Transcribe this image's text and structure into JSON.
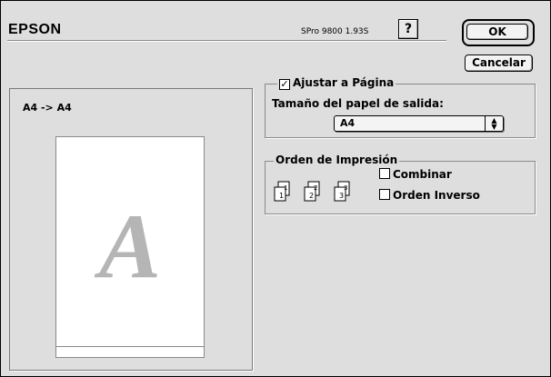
{
  "header": {
    "brand": "EPSON",
    "version": "SPro 9800 1.93S",
    "help_label": "?",
    "ok_label": "OK",
    "cancel_label": "Cancelar"
  },
  "preview": {
    "mapping": "A4 -> A4",
    "page_letter": "A"
  },
  "fit_to_page": {
    "label": "Ajustar a Página",
    "checked": true,
    "size_label": "Tamaño del papel de salida:",
    "paper_size": "A4"
  },
  "print_order": {
    "legend": "Orden de Impresión",
    "icons": [
      "1",
      "2",
      "3"
    ],
    "options": [
      {
        "label": "Combinar",
        "checked": false
      },
      {
        "label": "Orden Inverso",
        "checked": false
      }
    ]
  }
}
